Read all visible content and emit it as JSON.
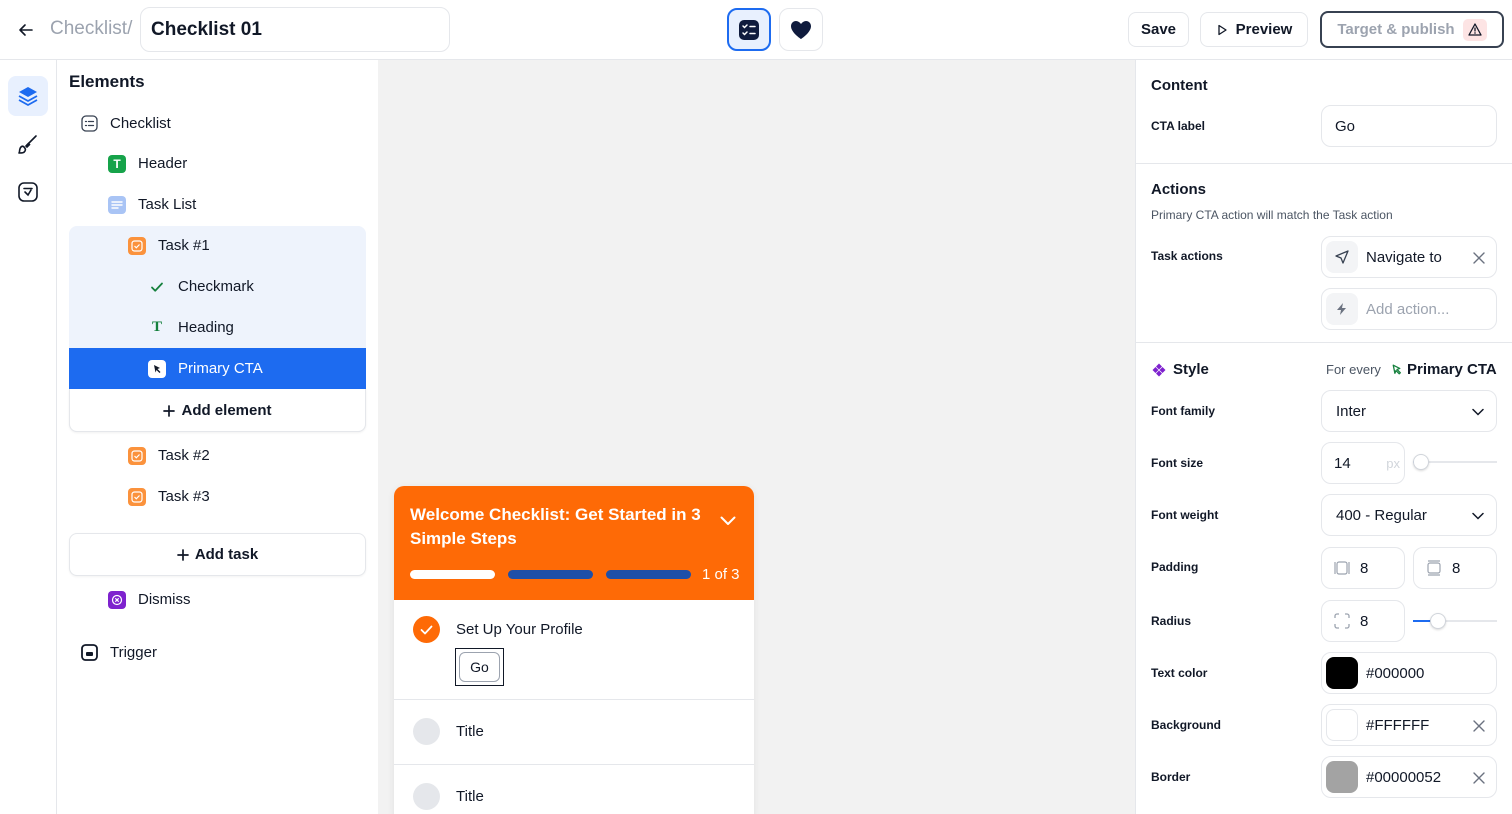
{
  "topbar": {
    "breadcrumb": "Checklist/",
    "title_value": "Checklist 01",
    "save_label": "Save",
    "preview_label": "Preview",
    "publish_label": "Target & publish"
  },
  "elements_panel": {
    "title": "Elements",
    "items": {
      "checklist": "Checklist",
      "header": "Header",
      "task_list": "Task List",
      "task1": "Task #1",
      "checkmark": "Checkmark",
      "heading": "Heading",
      "primary_cta": "Primary CTA",
      "add_element": "Add element",
      "task2": "Task #2",
      "task3": "Task #3",
      "add_task": "Add task",
      "dismiss": "Dismiss",
      "trigger": "Trigger"
    }
  },
  "canvas": {
    "widget_title": "Welcome Checklist: Get Started in 3 Simple Steps",
    "progress": {
      "completed": 1,
      "total": 3,
      "text": "1 of 3"
    },
    "tasks": [
      {
        "title": "Set Up Your Profile",
        "done": true,
        "cta": "Go"
      },
      {
        "title": "Title",
        "done": false
      },
      {
        "title": "Title",
        "done": false
      }
    ]
  },
  "properties": {
    "content": {
      "title": "Content",
      "cta_label_label": "CTA label",
      "cta_label_value": "Go"
    },
    "actions": {
      "title": "Actions",
      "subtitle": "Primary CTA action will match the Task action",
      "task_actions_label": "Task actions",
      "task_action_value": "Navigate to",
      "add_action_placeholder": "Add action..."
    },
    "style": {
      "title": "Style",
      "for_every": "For every",
      "target": "Primary CTA",
      "font_family_label": "Font family",
      "font_family_value": "Inter",
      "font_size_label": "Font size",
      "font_size_value": "14",
      "font_size_unit": "px",
      "font_size_slider": 0.1,
      "font_weight_label": "Font weight",
      "font_weight_value": "400 - Regular",
      "padding_label": "Padding",
      "padding_x": "8",
      "padding_y": "8",
      "radius_label": "Radius",
      "radius_value": "8",
      "radius_slider": 0.3,
      "text_color_label": "Text color",
      "text_color_value": "#000000",
      "background_label": "Background",
      "background_value": "#FFFFFF",
      "border_label": "Border",
      "border_value": "#00000052"
    }
  },
  "colors": {
    "accent": "#1d6bf0",
    "brand_orange": "#fe6a06",
    "progress_done": "#ffffff",
    "progress_todo": "#1e4fa8"
  }
}
